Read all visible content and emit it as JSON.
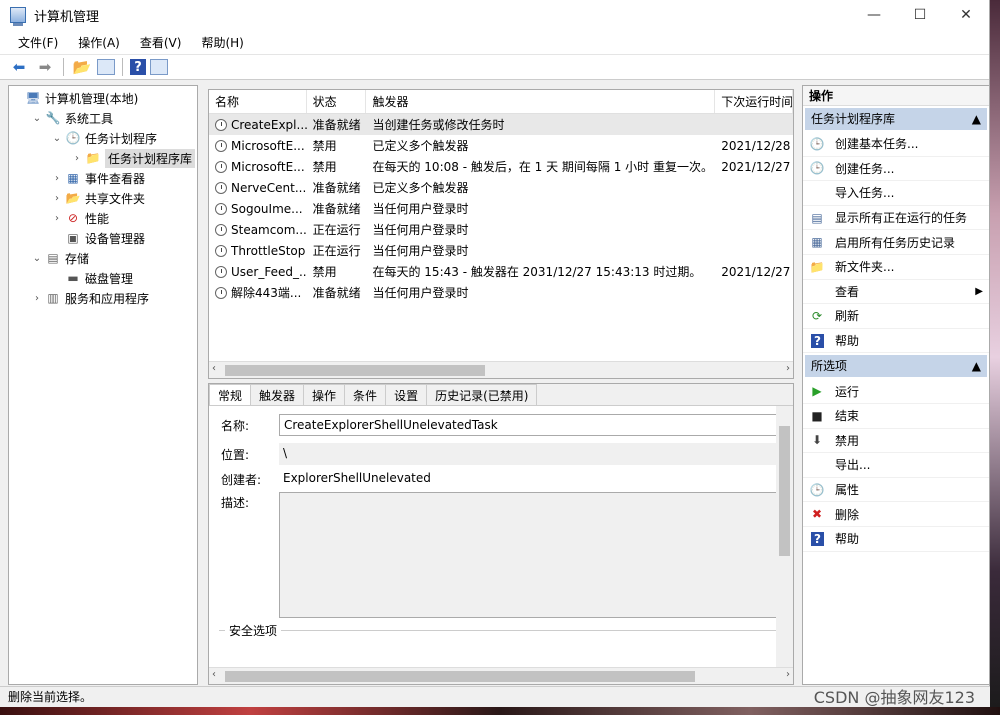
{
  "window": {
    "title": "计算机管理",
    "min": "—",
    "max": "☐",
    "close": "✕"
  },
  "menu": [
    "文件(F)",
    "操作(A)",
    "查看(V)",
    "帮助(H)"
  ],
  "tree": [
    {
      "label": "计算机管理(本地)",
      "level": 0,
      "exp": "",
      "icon": "computer-management-icon"
    },
    {
      "label": "系统工具",
      "level": 1,
      "exp": "⌄",
      "icon": "system-tools-icon"
    },
    {
      "label": "任务计划程序",
      "level": 2,
      "exp": "⌄",
      "icon": "task-scheduler-icon"
    },
    {
      "label": "任务计划程序库",
      "level": 3,
      "exp": "›",
      "icon": "folder-clock-icon",
      "selected": true
    },
    {
      "label": "事件查看器",
      "level": 2,
      "exp": "›",
      "icon": "event-viewer-icon"
    },
    {
      "label": "共享文件夹",
      "level": 2,
      "exp": "›",
      "icon": "shared-folders-icon"
    },
    {
      "label": "性能",
      "level": 2,
      "exp": "›",
      "icon": "performance-icon"
    },
    {
      "label": "设备管理器",
      "level": 2,
      "exp": "",
      "icon": "device-manager-icon"
    },
    {
      "label": "存储",
      "level": 1,
      "exp": "⌄",
      "icon": "storage-icon"
    },
    {
      "label": "磁盘管理",
      "level": 2,
      "exp": "",
      "icon": "disk-management-icon"
    },
    {
      "label": "服务和应用程序",
      "level": 1,
      "exp": "›",
      "icon": "services-apps-icon"
    }
  ],
  "list": {
    "headers": [
      "名称",
      "状态",
      "触发器",
      "下次运行时间"
    ],
    "rows": [
      [
        "CreateExpl...",
        "准备就绪",
        "当创建任务或修改任务时",
        ""
      ],
      [
        "MicrosoftE...",
        "禁用",
        "已定义多个触发器",
        "2021/12/28"
      ],
      [
        "MicrosoftE...",
        "禁用",
        "在每天的 10:08 - 触发后，在 1 天 期间每隔 1 小时 重复一次。",
        "2021/12/27"
      ],
      [
        "NerveCent...",
        "准备就绪",
        "已定义多个触发器",
        ""
      ],
      [
        "SogouIme...",
        "准备就绪",
        "当任何用户登录时",
        ""
      ],
      [
        "Steamcom...",
        "正在运行",
        "当任何用户登录时",
        ""
      ],
      [
        "ThrottleStop",
        "正在运行",
        "当任何用户登录时",
        ""
      ],
      [
        "User_Feed_...",
        "禁用",
        "在每天的 15:43 - 触发器在 2031/12/27 15:43:13 时过期。",
        "2021/12/27"
      ],
      [
        "解除443端...",
        "准备就绪",
        "当任何用户登录时",
        ""
      ]
    ]
  },
  "detail": {
    "tabs": [
      "常规",
      "触发器",
      "操作",
      "条件",
      "设置",
      "历史记录(已禁用)"
    ],
    "name_label": "名称:",
    "name_value": "CreateExplorerShellUnelevatedTask",
    "location_label": "位置:",
    "location_value": "\\",
    "author_label": "创建者:",
    "author_value": "ExplorerShellUnelevated",
    "desc_label": "描述:",
    "security_label": "安全选项"
  },
  "actions": {
    "header": "操作",
    "section1": "任务计划程序库",
    "items1": [
      {
        "label": "创建基本任务...",
        "icon": "create-basic-task-icon"
      },
      {
        "label": "创建任务...",
        "icon": "create-task-icon"
      },
      {
        "label": "导入任务...",
        "icon": ""
      },
      {
        "label": "显示所有正在运行的任务",
        "icon": "running-tasks-icon"
      },
      {
        "label": "启用所有任务历史记录",
        "icon": "history-icon"
      },
      {
        "label": "新文件夹...",
        "icon": "new-folder-icon"
      },
      {
        "label": "查看",
        "icon": "",
        "submenu": true
      },
      {
        "label": "刷新",
        "icon": "refresh-icon"
      },
      {
        "label": "帮助",
        "icon": "help-icon"
      }
    ],
    "section2": "所选项",
    "items2": [
      {
        "label": "运行",
        "icon": "run-icon"
      },
      {
        "label": "结束",
        "icon": "end-icon"
      },
      {
        "label": "禁用",
        "icon": "disable-icon"
      },
      {
        "label": "导出...",
        "icon": ""
      },
      {
        "label": "属性",
        "icon": "properties-icon"
      },
      {
        "label": "删除",
        "icon": "delete-icon"
      },
      {
        "label": "帮助",
        "icon": "help-icon"
      }
    ]
  },
  "status": "删除当前选择。",
  "watermark": "CSDN @抽象网友123"
}
